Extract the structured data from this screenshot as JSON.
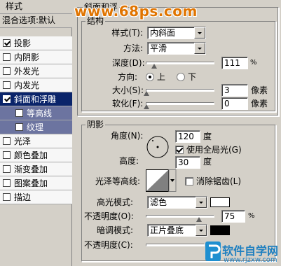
{
  "left_panel": {
    "header": "样式",
    "blend_options": "混合选项:默认",
    "items": [
      {
        "label": "投影",
        "checked": true
      },
      {
        "label": "内阴影",
        "checked": false
      },
      {
        "label": "外发光",
        "checked": false
      },
      {
        "label": "内发光",
        "checked": false
      },
      {
        "label": "斜面和浮雕",
        "checked": true
      },
      {
        "label": "等高线",
        "checked": false
      },
      {
        "label": "纹理",
        "checked": false
      },
      {
        "label": "光泽",
        "checked": false
      },
      {
        "label": "颜色叠加",
        "checked": false
      },
      {
        "label": "渐变叠加",
        "checked": false
      },
      {
        "label": "图案叠加",
        "checked": false
      },
      {
        "label": "描边",
        "checked": false
      }
    ]
  },
  "bevel": {
    "title": "斜面和浮",
    "structure_title": "结构",
    "style_label": "样式(T):",
    "style_value": "内斜面",
    "method_label": "方法:",
    "method_value": "平滑",
    "depth_label": "深度(D):",
    "depth_value": "111",
    "depth_unit": "%",
    "direction_label": "方向:",
    "dir_up": "上",
    "dir_down": "下",
    "size_label": "大小(S):",
    "size_value": "3",
    "size_unit": "像素",
    "soften_label": "软化(F):",
    "soften_value": "0",
    "soften_unit": "像素"
  },
  "shading": {
    "title": "阴影",
    "angle_label": "角度(N):",
    "angle_value": "120",
    "angle_unit": "度",
    "global_light_label": "使用全局光(G)",
    "altitude_label": "高度:",
    "altitude_value": "30",
    "altitude_unit": "度",
    "gloss_label": "光泽等高线:",
    "anti_alias_label": "消除锯齿(L)",
    "highlight_mode_label": "高光模式:",
    "highlight_mode_value": "滤色",
    "highlight_opacity_label": "不透明度(O):",
    "highlight_opacity_value": "75",
    "opacity_unit": "%",
    "shadow_mode_label": "暗调模式:",
    "shadow_mode_value": "正片叠底",
    "shadow_opacity_label": "不透明度(C):",
    "highlight_color": "#ffffff",
    "shadow_color": "#000000"
  },
  "watermarks": {
    "top": "www.68ps.com",
    "bottom_logo": "软件自学网",
    "bottom_url": "www.rjzxw.com"
  }
}
